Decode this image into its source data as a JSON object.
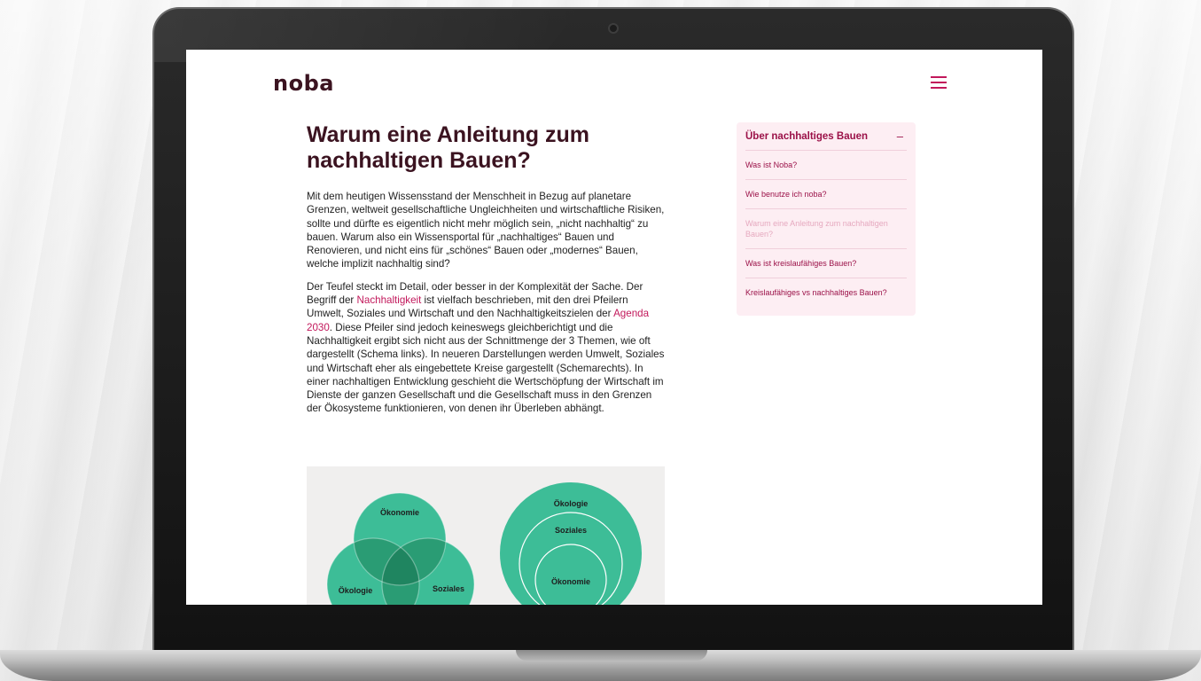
{
  "site": {
    "logo": "noba",
    "menu_icon": "hamburger-icon"
  },
  "article": {
    "title": "Warum eine Anleitung zum nachhaltigen Bauen?",
    "para1": "Mit dem heutigen Wissensstand der Menschheit in Bezug auf planetare Grenzen, weltweit gesellschaftliche Ungleichheiten und wirtschaftliche Risiken, sollte und dürfte es eigentlich nicht mehr möglich sein, „nicht nachhaltig“ zu bauen. Warum also ein Wissensportal für „nachhaltiges“ Bauen und Renovieren, und nicht eins für „schönes“ Bauen oder „modernes“ Bauen, welche implizit nachhaltig sind?",
    "para2": {
      "t1": "Der Teufel steckt im Detail, oder besser in der Komplexität der Sache. Der Begriff der ",
      "link1": "Nachhaltigkeit",
      "t2": " ist vielfach beschrieben, mit den drei Pfeilern Umwelt, Soziales und Wirtschaft und den Nachhaltigkeitszielen der ",
      "link2": "Agenda 2030",
      "t3": ". Diese Pfeiler sind jedoch keineswegs gleichberichtigt und die Nachhaltigkeit ergibt sich nicht aus der Schnittmenge der 3 Themen, wie oft dargestellt (Schema links). In neueren Darstellungen werden Umwelt, Soziales und Wirtschaft eher als eingebettete Kreise gargestellt (Schemarechts). In einer nachhaltigen Entwicklung geschieht die Wertschöpfung der Wirtschaft im Dienste der ganzen Gesellschaft und die Gesellschaft muss in den Grenzen der Ökosysteme funktionieren, von denen ihr Überleben abhängt."
    }
  },
  "diagram": {
    "venn": {
      "top": "Ökonomie",
      "left": "Ökologie",
      "right": "Soziales"
    },
    "nested": {
      "outer": "Ökologie",
      "middle": "Soziales",
      "inner": "Ökonomie"
    },
    "colors": {
      "circle": "#3dbd97",
      "overlap": "#2a9c74",
      "center": "#1f8560",
      "stroke": "#ffffff",
      "background": "#f0efee"
    }
  },
  "toc": {
    "title": "Über nachhaltiges Bauen",
    "toggle": "–",
    "items": [
      {
        "label": "Was ist Noba?",
        "active": false
      },
      {
        "label": "Wie benutze ich noba?",
        "active": false
      },
      {
        "label": "Warum eine Anleitung zum nachhaltigen Bauen?",
        "active": true
      },
      {
        "label": "Was ist kreislaufähiges Bauen?",
        "active": false
      },
      {
        "label": "Kreislaufähiges vs nachhaltiges Bauen?",
        "active": false
      }
    ]
  },
  "colors": {
    "brand": "#c2185b",
    "heading": "#3b1320",
    "toc_bg": "#fdeef3",
    "toc_text": "#9b1148",
    "toc_active": "#e6a9bf"
  }
}
